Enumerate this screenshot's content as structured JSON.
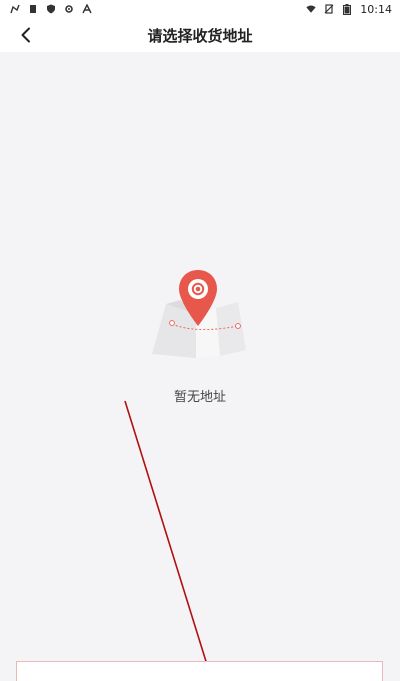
{
  "status_bar": {
    "time": "10:14",
    "left_icons": [
      "flag-icon",
      "clipboard-icon",
      "shield-icon",
      "gear-icon",
      "font-icon"
    ],
    "right_icons": [
      "wifi-icon",
      "no-sim-icon",
      "battery-icon"
    ]
  },
  "header": {
    "title": "请选择收货地址",
    "back_icon": "chevron-left-icon"
  },
  "empty_state": {
    "message": "暂无地址",
    "illustration": "map-pin-icon"
  },
  "colors": {
    "accent_red": "#e8574b",
    "background": "#f4f4f6",
    "annotation_line": "#b01010"
  }
}
